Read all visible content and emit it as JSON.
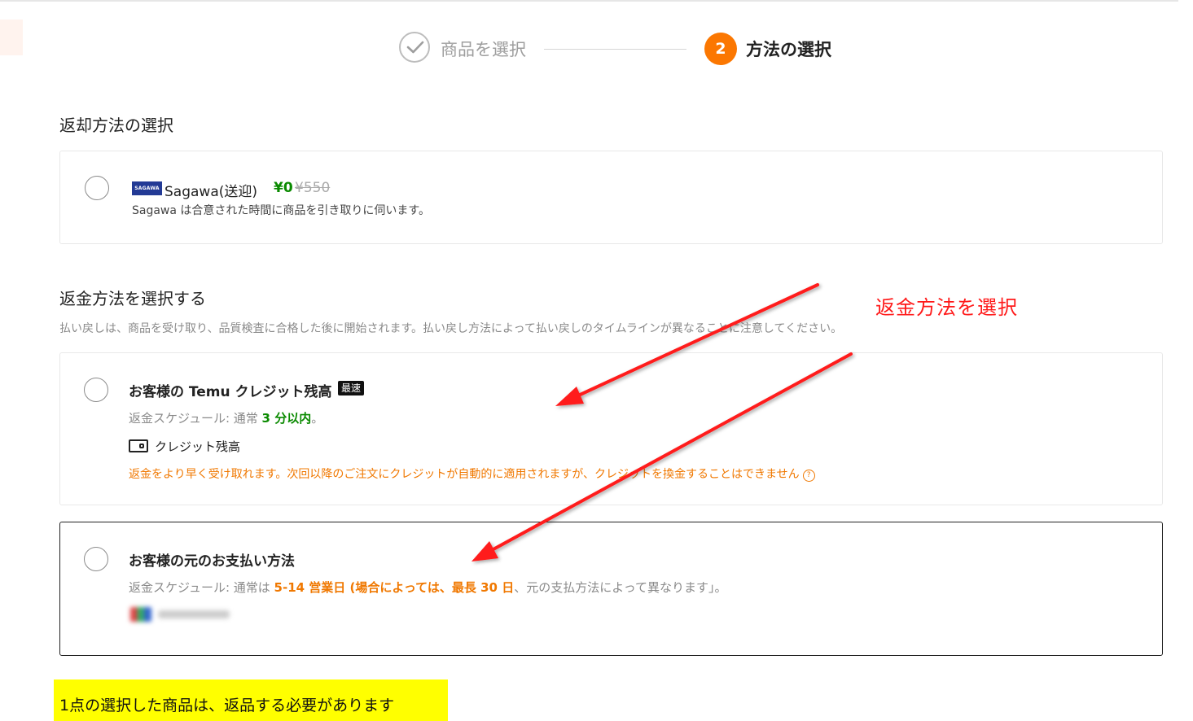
{
  "stepper": {
    "step1_label": "商品を選択",
    "step2_number": "2",
    "step2_label": "方法の選択"
  },
  "return_section": {
    "title": "返却方法の選択",
    "carrier": {
      "logo_text": "SAGAWA",
      "name": "Sagawa(送迎)",
      "price": "¥0",
      "original_price": "¥550",
      "description": "Sagawa は合意された時間に商品を引き取りに伺います。"
    }
  },
  "refund_section": {
    "title": "返金方法を選択する",
    "note": "払い戻しは、商品を受け取り、品質検査に合格した後に開始されます。払い戻し方法によって払い戻しのタイムラインが異なることに注意してください。",
    "options": [
      {
        "title": "お客様の Temu クレジット残高",
        "badge": "最速",
        "schedule_prefix": "返金スケジュール: 通常 ",
        "schedule_highlight": "3 分以内",
        "schedule_suffix": "。",
        "method_label": "クレジット残高",
        "note": "返金をより早く受け取れます。次回以降のご注文にクレジットが自動的に適用されますが、クレジットを換金することはできません",
        "help_icon": "?"
      },
      {
        "title": "お客様の元のお支払い方法",
        "schedule_prefix": "返金スケジュール: 通常は ",
        "schedule_highlight": "5-14 営業日 (場合によっては、最長 30 日",
        "schedule_suffix": "、元の支払方法によって異なります」。"
      }
    ]
  },
  "annotation": {
    "label": "返金方法を選択",
    "color": "#ff1a1a"
  },
  "footer_highlight": "1点の選択した商品は、返品する必要があります",
  "colors": {
    "accent": "#fb7701",
    "price_green": "#0a8a00",
    "warning_orange": "#f07800",
    "highlight_yellow": "#ffff00"
  }
}
